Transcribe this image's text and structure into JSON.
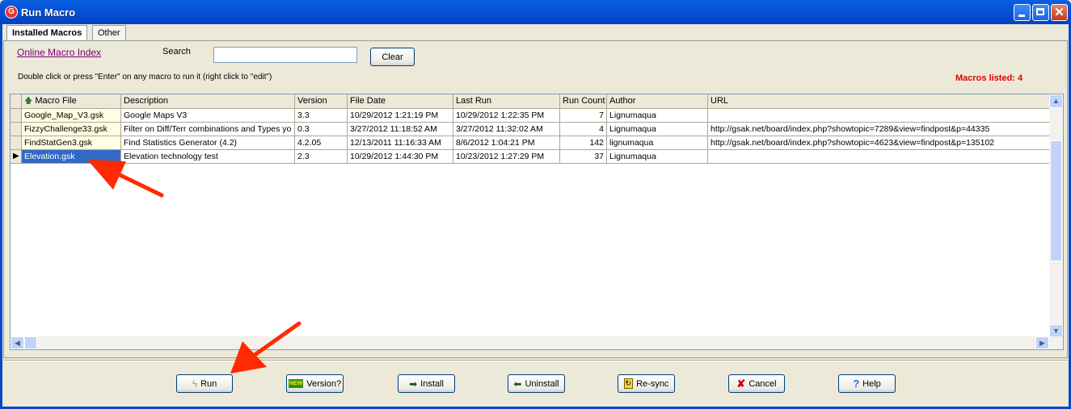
{
  "window": {
    "title": "Run Macro",
    "close_glyph": "✕"
  },
  "tabs": [
    {
      "label": "Installed Macros"
    },
    {
      "label": "Other"
    }
  ],
  "toolbar": {
    "online_index_link": "Online Macro Index",
    "search_label": "Search",
    "search_value": "",
    "clear_label": "Clear"
  },
  "hint": "Double click or press \"Enter\" on any macro to run it (right click to \"edit\")",
  "macros_listed": "Macros listed: 4",
  "table": {
    "columns": [
      "Macro File",
      "Description",
      "Version",
      "File Date",
      "Last Run",
      "Run Count",
      "Author",
      "URL"
    ],
    "rows": [
      [
        "Google_Map_V3.gsk",
        "Google Maps V3",
        "3.3",
        "10/29/2012 1:21:19 PM",
        "10/29/2012 1:22:35 PM",
        "7",
        "Lignumaqua",
        ""
      ],
      [
        "FizzyChallenge33.gsk",
        "Filter on Diff/Terr combinations and Types yo",
        "0.3",
        "3/27/2012 11:18:52 AM",
        "3/27/2012 11:32:02 AM",
        "4",
        "Lignumaqua",
        "http://gsak.net/board/index.php?showtopic=7289&view=findpost&p=44335"
      ],
      [
        "FindStatGen3.gsk",
        "Find Statistics Generator (4.2)",
        "4.2.05",
        "12/13/2011 11:16:33 AM",
        "8/6/2012 1:04:21 PM",
        "142",
        "lignumaqua",
        "http://gsak.net/board/index.php?showtopic=4623&view=findpost&p=135102"
      ],
      [
        "Elevation.gsk",
        "Elevation technology test",
        "2.3",
        "10/29/2012 1:44:30 PM",
        "10/23/2012 1:27:29 PM",
        "37",
        "Lignumaqua",
        ""
      ]
    ],
    "selected_row": 3
  },
  "buttons": {
    "run": "Run",
    "version": "Version?",
    "version_badge": "NEW",
    "install": "Install",
    "uninstall": "Uninstall",
    "resync": "Re-sync",
    "cancel": "Cancel",
    "help": "Help"
  },
  "colors": {
    "title_bar": "#0553d8",
    "selection": "#316ac5",
    "count_text": "#e00000",
    "annotation_arrow": "#ff2a00"
  }
}
